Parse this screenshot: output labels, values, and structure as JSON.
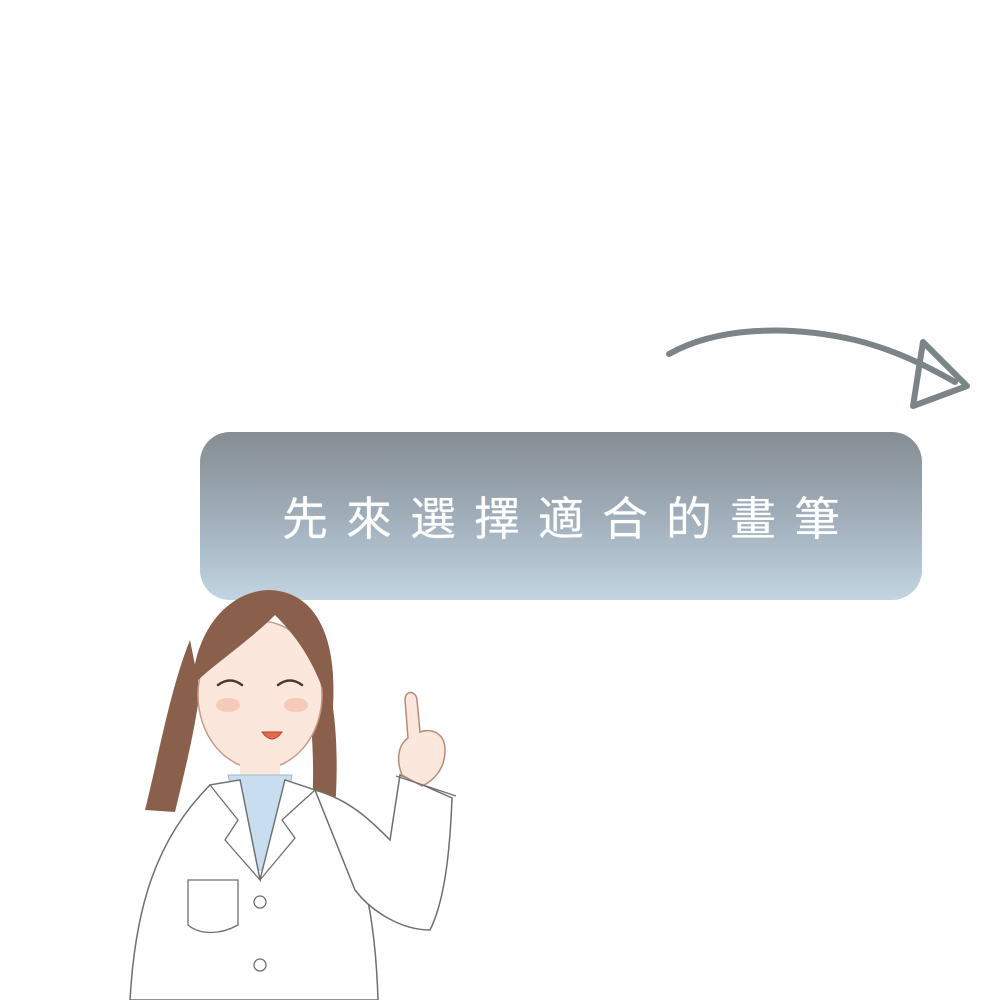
{
  "banner": {
    "text": "先來選擇適合的畫筆"
  },
  "colors": {
    "background": "#ffffff",
    "banner_top": "#868d93",
    "banner_bottom": "#c3d5e2",
    "banner_text": "#ffffff",
    "arrow": "#7b8587",
    "hair": "#8a5f4c",
    "coat": "#ffffff",
    "shirt": "#c8def0"
  },
  "illustration": {
    "figure": "doctor-illustration",
    "gesture": "pointing-up-icon",
    "arrow": "curved-arrow-right-icon"
  }
}
